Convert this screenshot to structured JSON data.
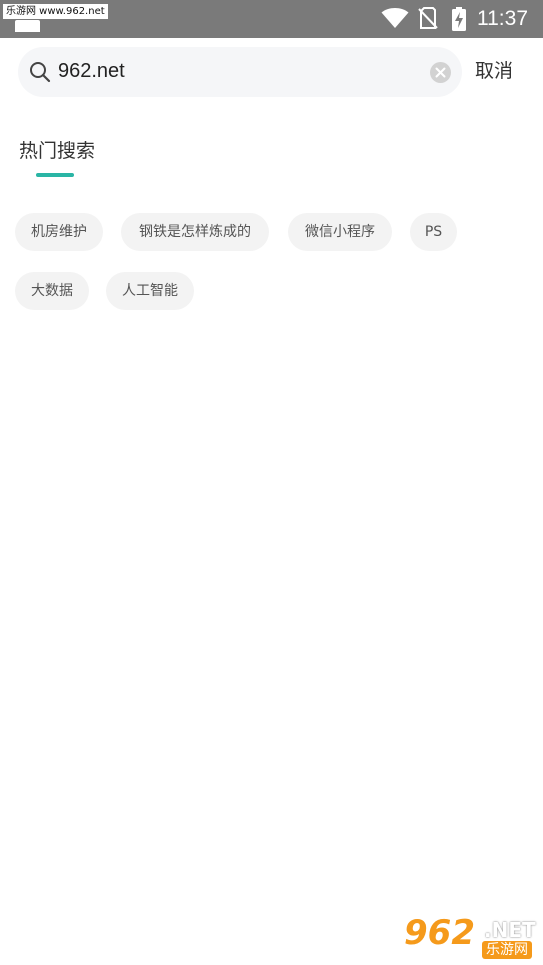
{
  "status_bar": {
    "watermark_text": "乐游网 www.962.net",
    "time": "11:37",
    "icons": [
      "wifi-icon",
      "no-sim-icon",
      "battery-charging-icon"
    ]
  },
  "search": {
    "value": "962.net",
    "search_icon": "search-icon",
    "clear_icon": "clear-icon",
    "cancel_label": "取消"
  },
  "hot_search": {
    "title": "热门搜索",
    "accent_color": "#2ab5a5",
    "tags": [
      {
        "label": "机房维护"
      },
      {
        "label": "钢铁是怎样炼成的"
      },
      {
        "label": "微信小程序"
      },
      {
        "label": "PS"
      },
      {
        "label": "大数据"
      },
      {
        "label": "人工智能"
      }
    ]
  },
  "watermark": {
    "number": "962",
    "suffix": ".NET",
    "chinese": "乐游网"
  }
}
